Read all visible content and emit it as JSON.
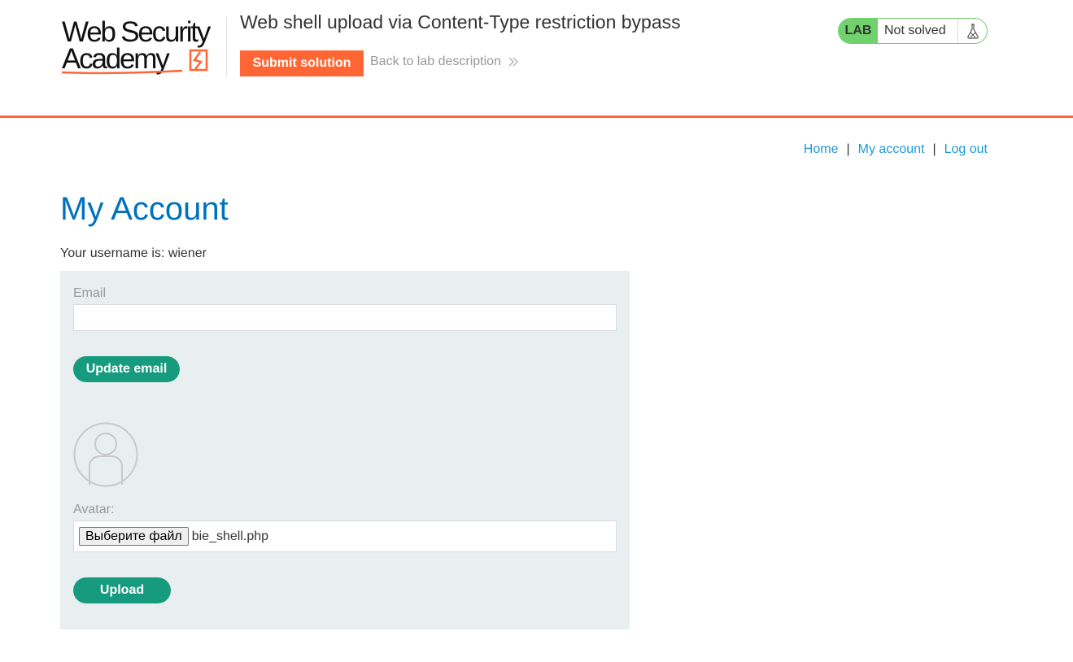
{
  "header": {
    "logo": {
      "line1": "Web Security",
      "line2": "Academy"
    },
    "lab_title": "Web shell upload via Content-Type restriction bypass",
    "submit_label": "Submit solution",
    "back_link_label": "Back to lab description",
    "lab_tag": "LAB",
    "lab_status": "Not solved",
    "colors": {
      "accent": "#ff6633",
      "solved_green": "#70d16d"
    }
  },
  "nav": {
    "home": "Home",
    "separator": "|",
    "my_account": "My account",
    "log_out": "Log out"
  },
  "main": {
    "title": "My Account",
    "username_line": "Your username is: wiener",
    "email_label": "Email",
    "email_value": "",
    "update_email_label": "Update email",
    "avatar_label": "Avatar:",
    "file_button_label": "Выберите файл",
    "file_name": "bie_shell.php",
    "upload_label": "Upload",
    "colors": {
      "button_green": "#179b7e",
      "title_blue": "#0071bc",
      "link_blue": "#1a9bd7",
      "panel_bg": "#e9eef1"
    }
  },
  "icons": {
    "logo": "web-security-academy-logo",
    "back_chevron": "double-chevron-right-icon",
    "flask": "flask-icon",
    "avatar": "user-avatar-placeholder-icon"
  }
}
